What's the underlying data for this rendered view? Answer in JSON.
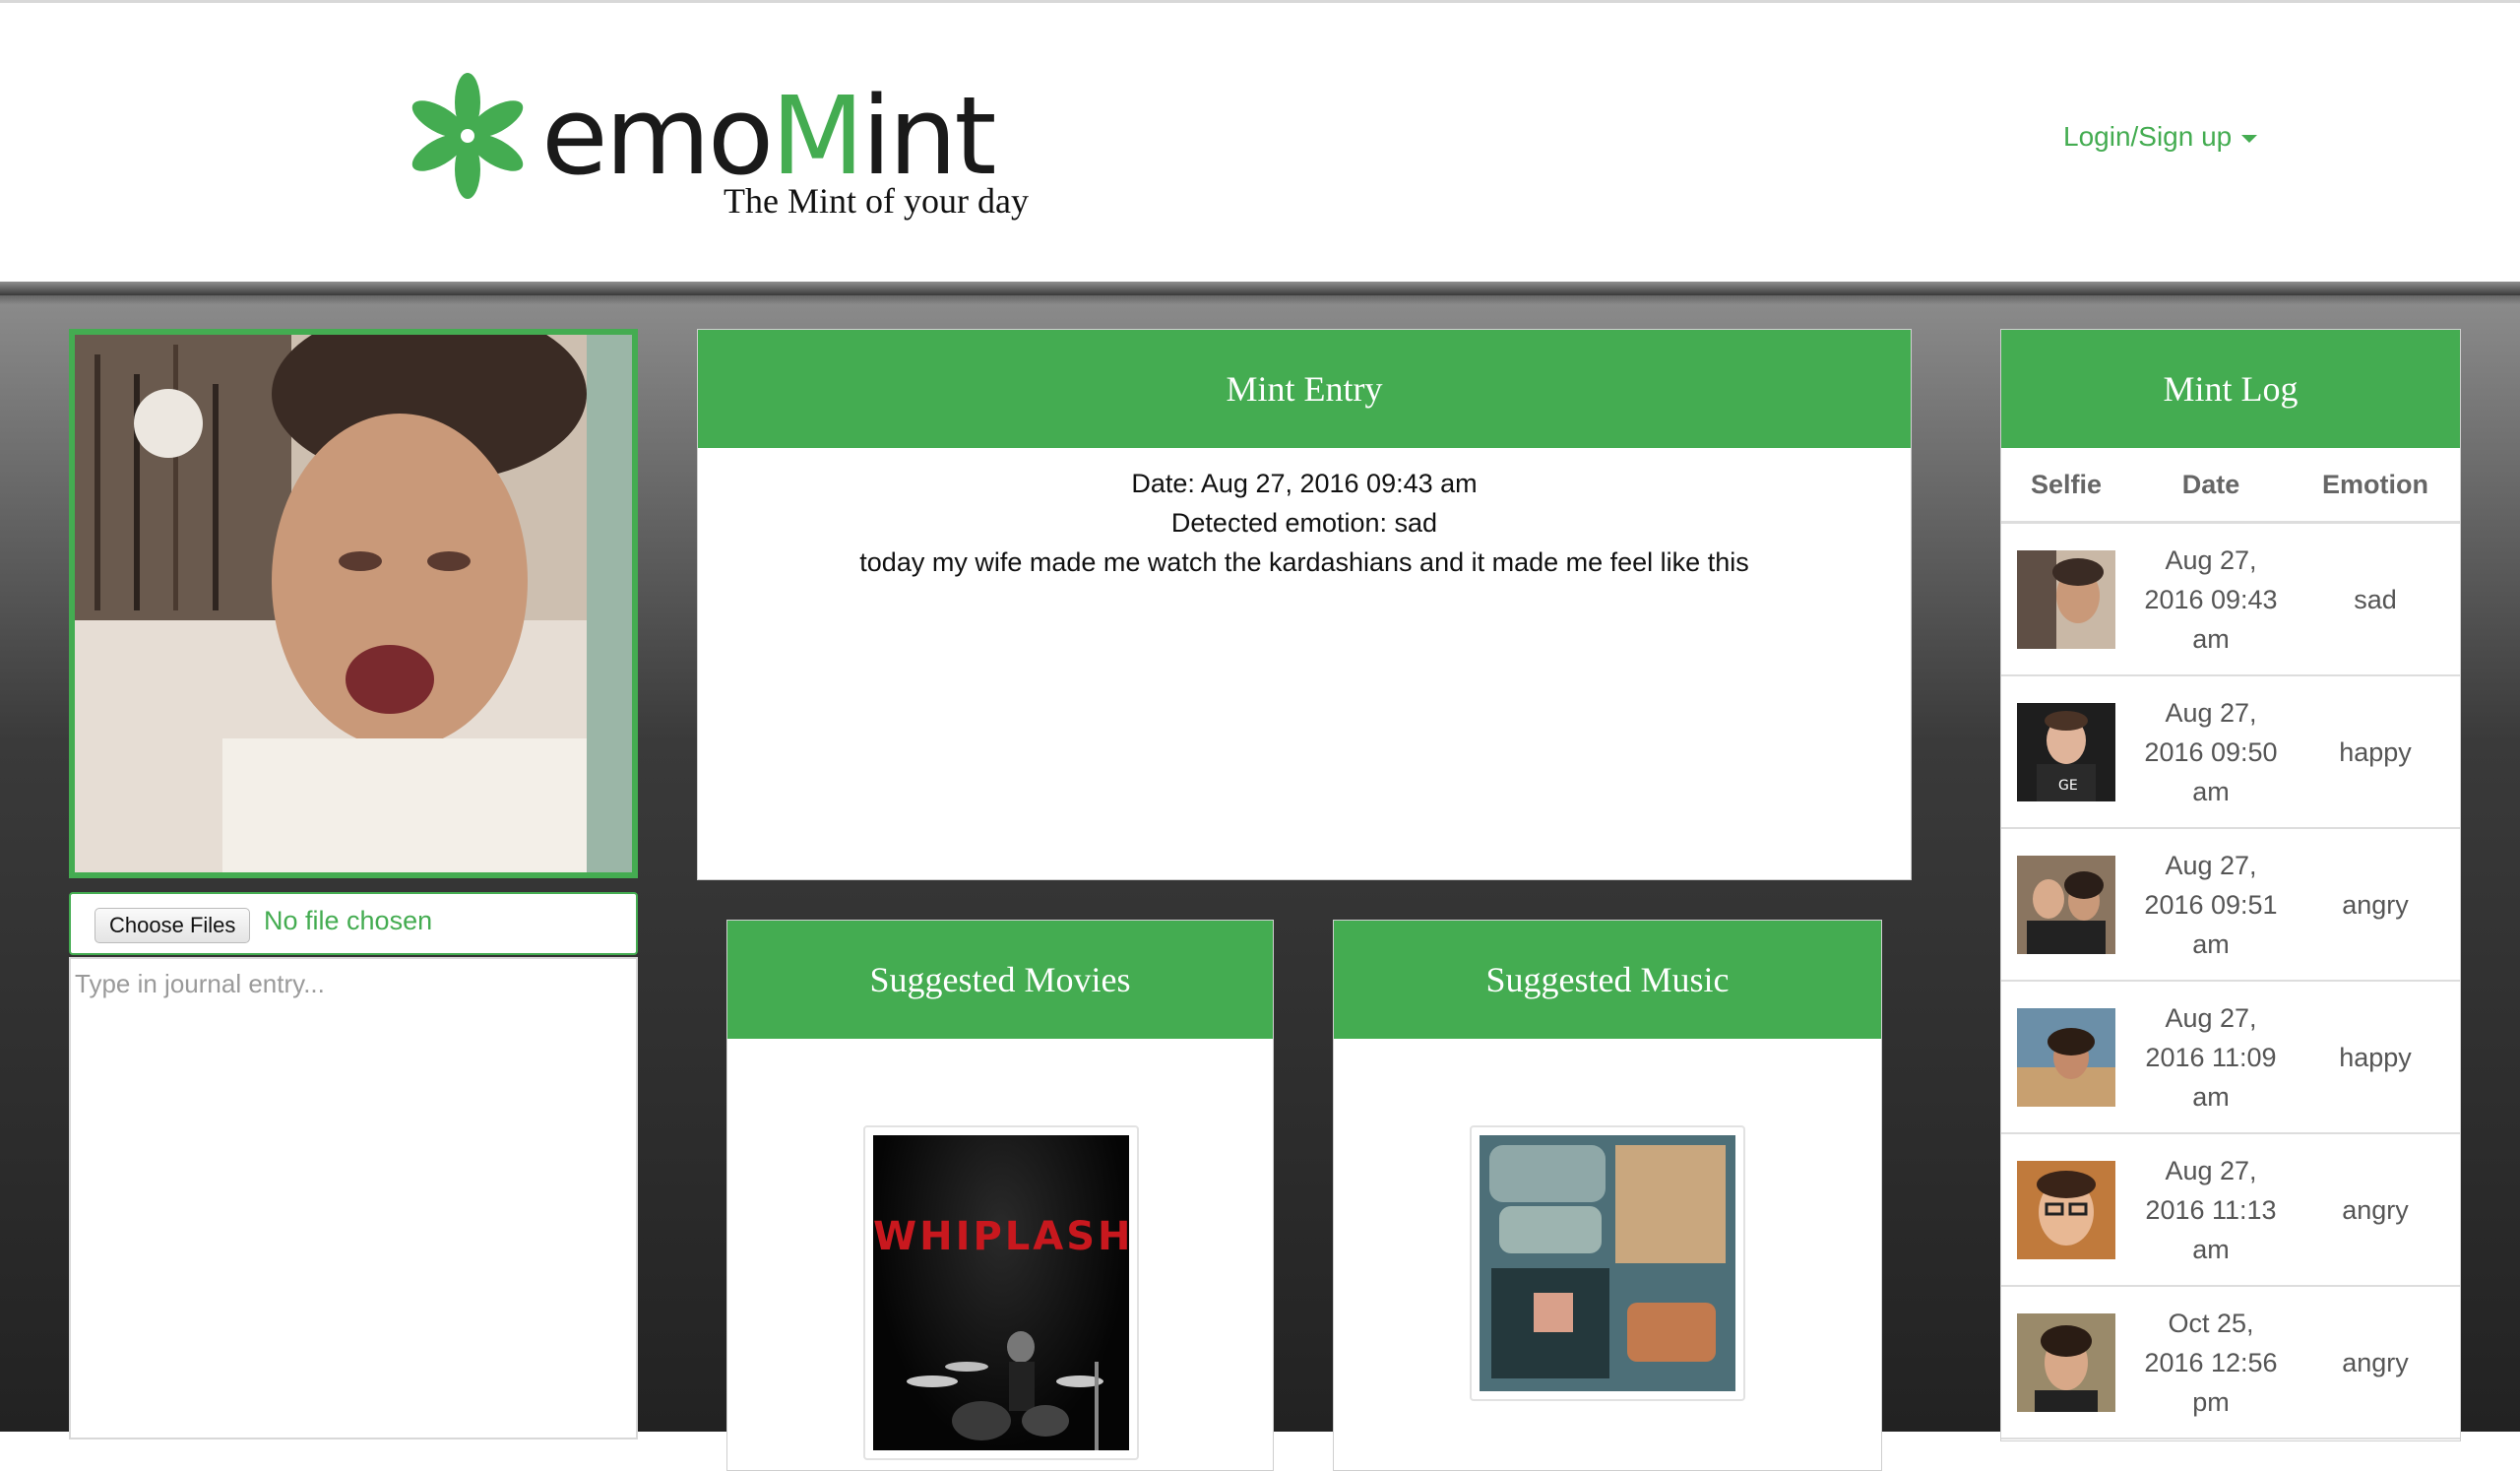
{
  "brand": {
    "name_part1": "emo",
    "name_part2": "M",
    "name_part3": "int",
    "tagline": "The Mint of your day",
    "accent_color": "#44ac51"
  },
  "nav": {
    "login_label": "Login/Sign up",
    "caret_icon": "caret-down-icon"
  },
  "upload": {
    "choose_label": "Choose Files",
    "file_status": "No file chosen",
    "journal_placeholder": "Type in journal entry..."
  },
  "entry": {
    "title": "Mint Entry",
    "date_line": "Date: Aug 27, 2016 09:43 am",
    "emotion_line": "Detected emotion: sad",
    "text": "today my wife made me watch the kardashians and it made me feel like this"
  },
  "movies": {
    "title": "Suggested Movies",
    "poster_title": "WHIPLASH"
  },
  "music": {
    "title": "Suggested Music"
  },
  "log": {
    "title": "Mint Log",
    "columns": [
      "Selfie",
      "Date",
      "Emotion"
    ],
    "rows": [
      {
        "date": [
          "Aug 27,",
          "2016 09:43",
          "am"
        ],
        "emotion": "sad"
      },
      {
        "date": [
          "Aug 27,",
          "2016 09:50",
          "am"
        ],
        "emotion": "happy"
      },
      {
        "date": [
          "Aug 27,",
          "2016 09:51",
          "am"
        ],
        "emotion": "angry"
      },
      {
        "date": [
          "Aug 27,",
          "2016 11:09",
          "am"
        ],
        "emotion": "happy"
      },
      {
        "date": [
          "Aug 27,",
          "2016 11:13",
          "am"
        ],
        "emotion": "angry"
      },
      {
        "date": [
          "Oct 25,",
          "2016 12:56",
          "pm"
        ],
        "emotion": "angry"
      }
    ]
  }
}
